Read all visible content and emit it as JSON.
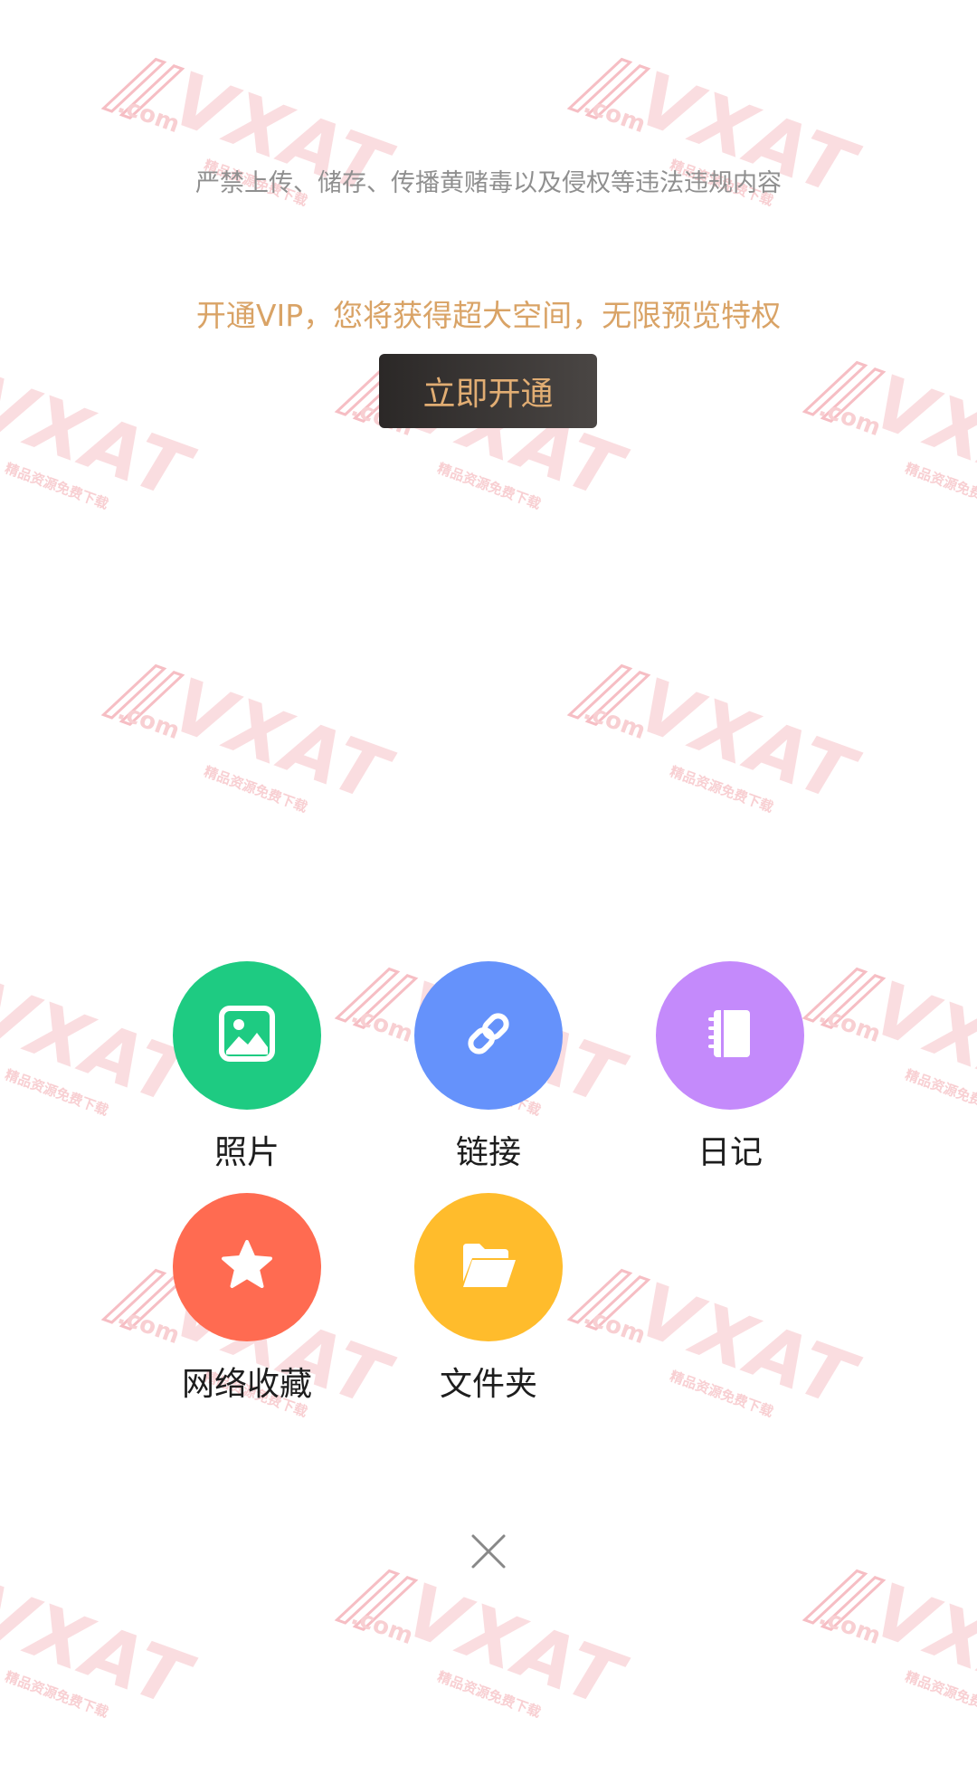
{
  "notice": "严禁上传、储存、传播黄赌毒以及侵权等违法违规内容",
  "vip": {
    "promo": "开通VIP，您将获得超大空间，无限预览特权",
    "button_label": "立即开通"
  },
  "actions": [
    {
      "label": "照片",
      "icon": "photo-icon",
      "color": "#1ecb82"
    },
    {
      "label": "链接",
      "icon": "link-icon",
      "color": "#6592fb"
    },
    {
      "label": "日记",
      "icon": "diary-icon",
      "color": "#c48afb"
    },
    {
      "label": "网络收藏",
      "icon": "star-icon",
      "color": "#ff6b51"
    },
    {
      "label": "文件夹",
      "icon": "folder-icon",
      "color": "#ffbc2c"
    }
  ],
  "close": {
    "icon": "close-icon"
  },
  "watermark": {
    "brand": "VXAT",
    "domain": ".com",
    "tagline": "精品资源免费下载"
  }
}
